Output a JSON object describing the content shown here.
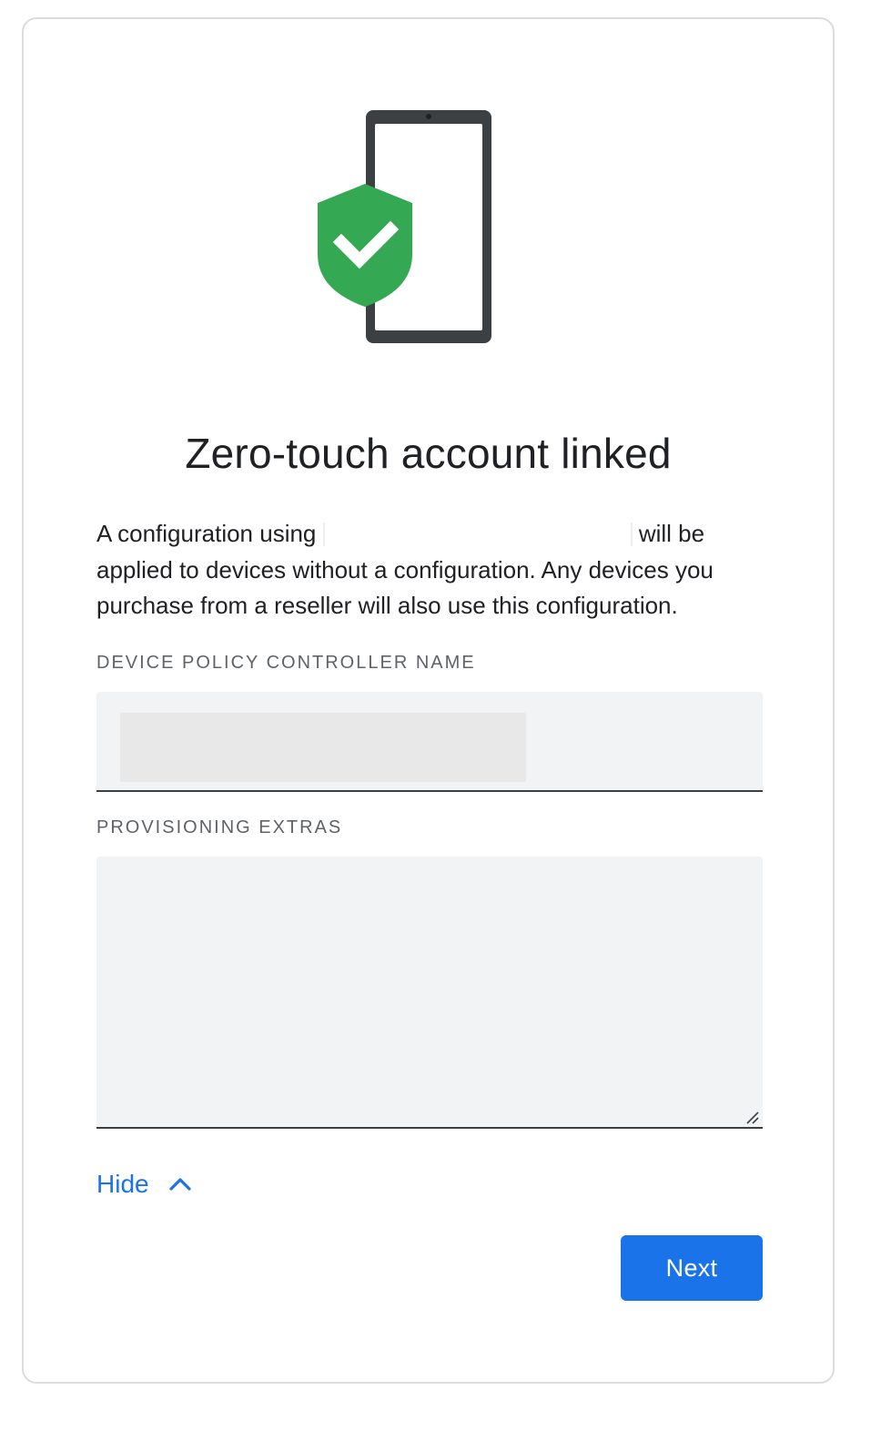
{
  "dialog": {
    "title": "Zero-touch account linked",
    "description_before": "A configuration using ",
    "description_after": " will be applied to devices without a configuration. Any devices you purchase from a reseller will also use this configuration.",
    "illustration_icon": "phone-with-shield-check-icon"
  },
  "fields": {
    "dpc_name": {
      "label": "DEVICE POLICY CONTROLLER NAME",
      "value": ""
    },
    "provisioning_extras": {
      "label": "PROVISIONING EXTRAS",
      "value": ""
    }
  },
  "actions": {
    "hide_label": "Hide",
    "next_label": "Next"
  },
  "colors": {
    "accent": "#1a73e8",
    "shield": "#34a853",
    "field_bg": "#f1f3f4"
  }
}
